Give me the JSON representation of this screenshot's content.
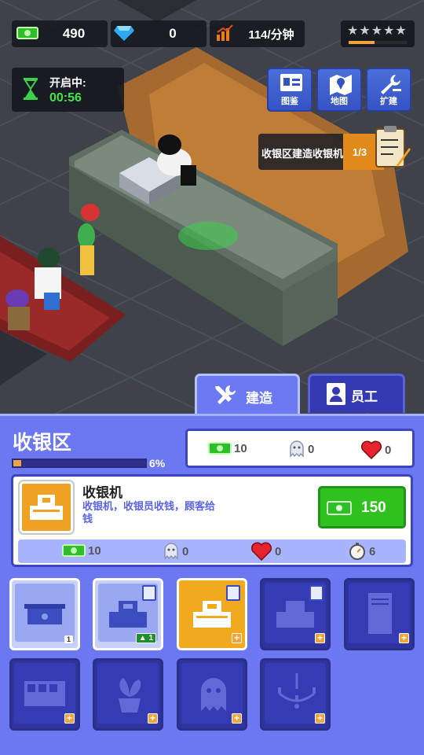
{
  "hud": {
    "cash": "490",
    "gems": "0",
    "income": "114/分钟",
    "star_progress": 0.45,
    "timer_label": "开启中:",
    "timer_value": "00:56"
  },
  "tools": [
    {
      "label": "图鉴",
      "icon": "catalog-icon"
    },
    {
      "label": "地图",
      "icon": "map-icon"
    },
    {
      "label": "扩建",
      "icon": "wrench-icon"
    }
  ],
  "task": {
    "text": "收银区建造收银机",
    "progress": "1/3"
  },
  "tabs": {
    "build": "建造",
    "staff": "员工"
  },
  "zone": {
    "name": "收银区",
    "progress_pct": "6%",
    "progress_value": 0.06,
    "stats": {
      "cash": "10",
      "ghost": "0",
      "heart": "0"
    }
  },
  "item": {
    "name": "收银机",
    "description": "收银机，收银员收钱，顾客给钱",
    "price": "150",
    "stats": {
      "cash": "10",
      "ghost": "0",
      "heart": "0",
      "speed": "6"
    }
  },
  "slots": [
    {
      "name": "counter-slot",
      "icon": "counter-icon",
      "badge": "1"
    },
    {
      "name": "cash-register-slot",
      "icon": "cash-register-icon",
      "badge": "1"
    },
    {
      "name": "cash-register-selected-slot",
      "icon": "cash-register-icon"
    },
    {
      "name": "cash-register-locked-slot",
      "icon": "cash-register-icon"
    },
    {
      "name": "cabinet-locked-slot",
      "icon": "cabinet-icon"
    },
    {
      "name": "fence-locked-slot",
      "icon": "fence-icon"
    },
    {
      "name": "plant-locked-slot",
      "icon": "plant-icon"
    },
    {
      "name": "ghost-locked-slot",
      "icon": "ghost-icon"
    },
    {
      "name": "chandelier-locked-slot",
      "icon": "chandelier-icon"
    }
  ],
  "colors": {
    "panel": "#6c78f1",
    "accent_orange": "#f0a322",
    "buy_green": "#2fc21e",
    "locked_slot": "#2e33a0"
  }
}
